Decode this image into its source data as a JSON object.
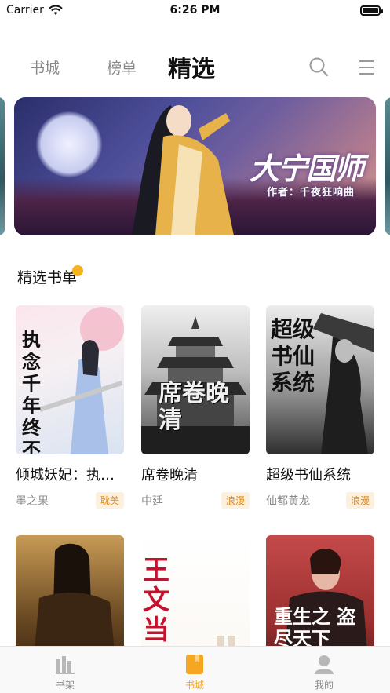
{
  "status_bar": {
    "carrier": "Carrier",
    "time": "6:26 PM"
  },
  "top_nav": {
    "tabs": [
      {
        "label": "书城",
        "active": false
      },
      {
        "label": "榜单",
        "active": false
      },
      {
        "label": "精选",
        "active": true
      }
    ],
    "icons": [
      "search-icon",
      "menu-icon"
    ]
  },
  "banner": {
    "title": "大宁国师",
    "author": "作者：千夜狂响曲"
  },
  "section": {
    "title": "精选书单"
  },
  "books": [
    {
      "title": "倾城妖妃：执…",
      "author": "墨之果",
      "tag": "耽美",
      "cover_text": "执念千年终不悔"
    },
    {
      "title": "席卷晚清",
      "author": "中廷",
      "tag": "浪漫",
      "cover_text": "席卷晚清"
    },
    {
      "title": "超级书仙系统",
      "author": "仙都黄龙",
      "tag": "浪漫",
      "cover_text": "超级书仙系统"
    },
    {
      "title": "",
      "author": "",
      "tag": "",
      "cover_text": ""
    },
    {
      "title": "",
      "author": "",
      "tag": "",
      "cover_text": "王文当"
    },
    {
      "title": "",
      "author": "",
      "tag": "",
      "cover_text": "重生之 盗尽天下"
    }
  ],
  "tab_bar": {
    "items": [
      {
        "label": "书架",
        "icon": "bookshelf-icon",
        "active": false
      },
      {
        "label": "书城",
        "icon": "bookstore-icon",
        "active": true
      },
      {
        "label": "我的",
        "icon": "profile-icon",
        "active": false
      }
    ]
  },
  "colors": {
    "accent": "#f5a623",
    "tag_text": "#e08a1c",
    "tag_bg": "#fdf0dd",
    "section_dot": "#f5b21c"
  }
}
